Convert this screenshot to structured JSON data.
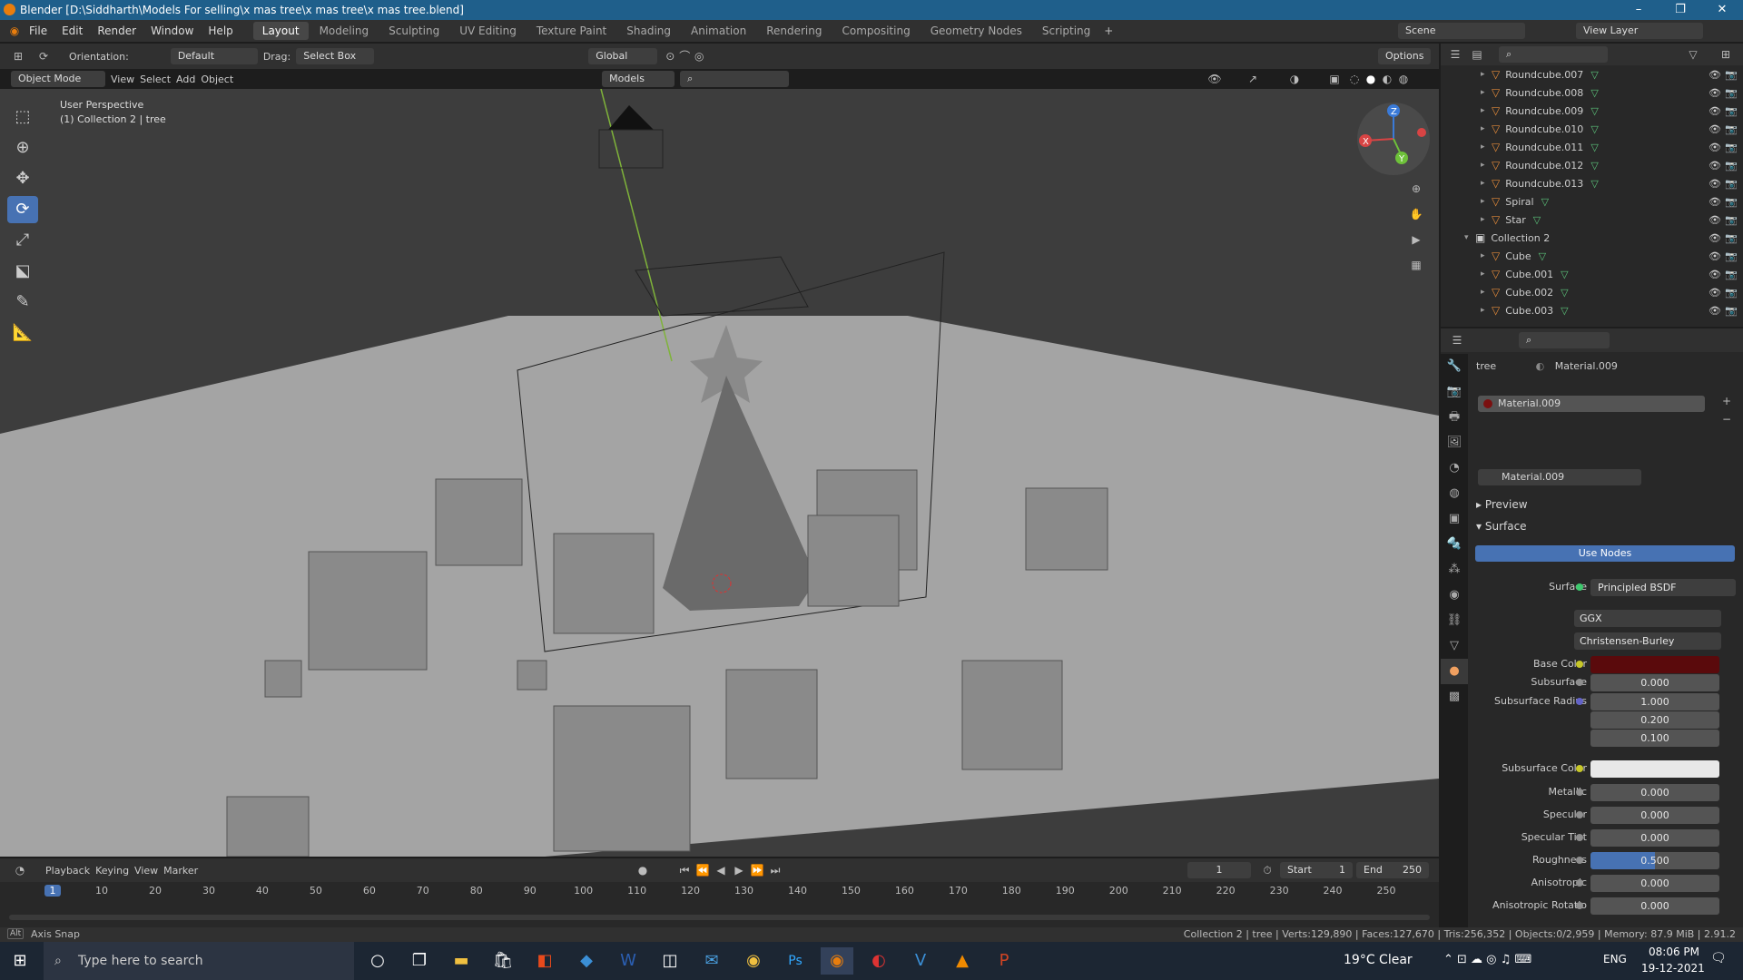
{
  "window": {
    "title": "Blender [D:\\Siddharth\\Models For selling\\x mas tree\\x mas tree\\x mas tree.blend]"
  },
  "menus": [
    "File",
    "Edit",
    "Render",
    "Window",
    "Help"
  ],
  "workspaces": [
    "Layout",
    "Modeling",
    "Sculpting",
    "UV Editing",
    "Texture Paint",
    "Shading",
    "Animation",
    "Rendering",
    "Compositing",
    "Geometry Nodes",
    "Scripting"
  ],
  "active_workspace": "Layout",
  "scene": "Scene",
  "view_layer": "View Layer",
  "header": {
    "orientation_label": "Orientation:",
    "orientation": "Default",
    "drag_label": "Drag:",
    "drag": "Select Box",
    "transform": "Global",
    "options": "Options",
    "mode": "Object Mode",
    "view": "View",
    "select": "Select",
    "add": "Add",
    "object": "Object",
    "collection_filter": "Models"
  },
  "viewport": {
    "line1": "User Perspective",
    "line2": "(1) Collection 2 | tree"
  },
  "outliner": [
    {
      "name": "Roundcube.007",
      "depth": 1
    },
    {
      "name": "Roundcube.008",
      "depth": 1
    },
    {
      "name": "Roundcube.009",
      "depth": 1
    },
    {
      "name": "Roundcube.010",
      "depth": 1
    },
    {
      "name": "Roundcube.011",
      "depth": 1
    },
    {
      "name": "Roundcube.012",
      "depth": 1
    },
    {
      "name": "Roundcube.013",
      "depth": 1
    },
    {
      "name": "Spiral",
      "depth": 1
    },
    {
      "name": "Star",
      "depth": 1
    },
    {
      "name": "Collection 2",
      "depth": 0
    },
    {
      "name": "Cube",
      "depth": 1
    },
    {
      "name": "Cube.001",
      "depth": 1
    },
    {
      "name": "Cube.002",
      "depth": 1
    },
    {
      "name": "Cube.003",
      "depth": 1
    }
  ],
  "properties": {
    "breadcrumb_object": "tree",
    "breadcrumb_material": "Material.009",
    "slot": "Material.009",
    "material_name": "Material.009",
    "preview": "Preview",
    "surface_panel": "Surface",
    "use_nodes": "Use Nodes",
    "surface_label": "Surface",
    "surface_value": "Principled BSDF",
    "distribution": "GGX",
    "subsurface_method": "Christensen-Burley",
    "base_color_label": "Base Color",
    "base_color": "#5a0a0c",
    "rows": [
      {
        "label": "Subsurface",
        "value": "0.000"
      },
      {
        "label": "Subsurface Radius",
        "value": "1.000"
      },
      {
        "label": "",
        "value": "0.200"
      },
      {
        "label": "",
        "value": "0.100"
      }
    ],
    "subsurface_color_label": "Subsurface Color",
    "subsurface_color": "#e8e8e8",
    "rows2": [
      {
        "label": "Metallic",
        "value": "0.000"
      },
      {
        "label": "Specular",
        "value": "0.000"
      },
      {
        "label": "Specular Tint",
        "value": "0.000"
      },
      {
        "label": "Roughness",
        "value": "0.500"
      },
      {
        "label": "Anisotropic",
        "value": "0.000"
      },
      {
        "label": "Anisotropic Rotatio",
        "value": "0.000"
      }
    ],
    "roughness_fraction": 0.5
  },
  "timeline": {
    "playback": "Playback",
    "keying": "Keying",
    "view": "View",
    "marker": "Marker",
    "current_frame": "1",
    "start_label": "Start",
    "start": "1",
    "end_label": "End",
    "end": "250",
    "ticks": [
      "1",
      "10",
      "20",
      "30",
      "40",
      "50",
      "60",
      "70",
      "80",
      "90",
      "100",
      "110",
      "120",
      "130",
      "140",
      "150",
      "160",
      "170",
      "180",
      "190",
      "200",
      "210",
      "220",
      "230",
      "240",
      "250"
    ]
  },
  "status": {
    "left_key": "Alt",
    "left": "Axis Snap",
    "right": "Collection 2 | tree | Verts:129,890 | Faces:127,670 | Tris:256,352 | Objects:0/2,959 | Memory: 87.9 MiB | 2.91.2"
  },
  "taskbar": {
    "search": "Type here to search",
    "weather": "19°C  Clear",
    "lang": "ENG",
    "time": "08:06 PM",
    "date": "19-12-2021",
    "notif": "2"
  }
}
